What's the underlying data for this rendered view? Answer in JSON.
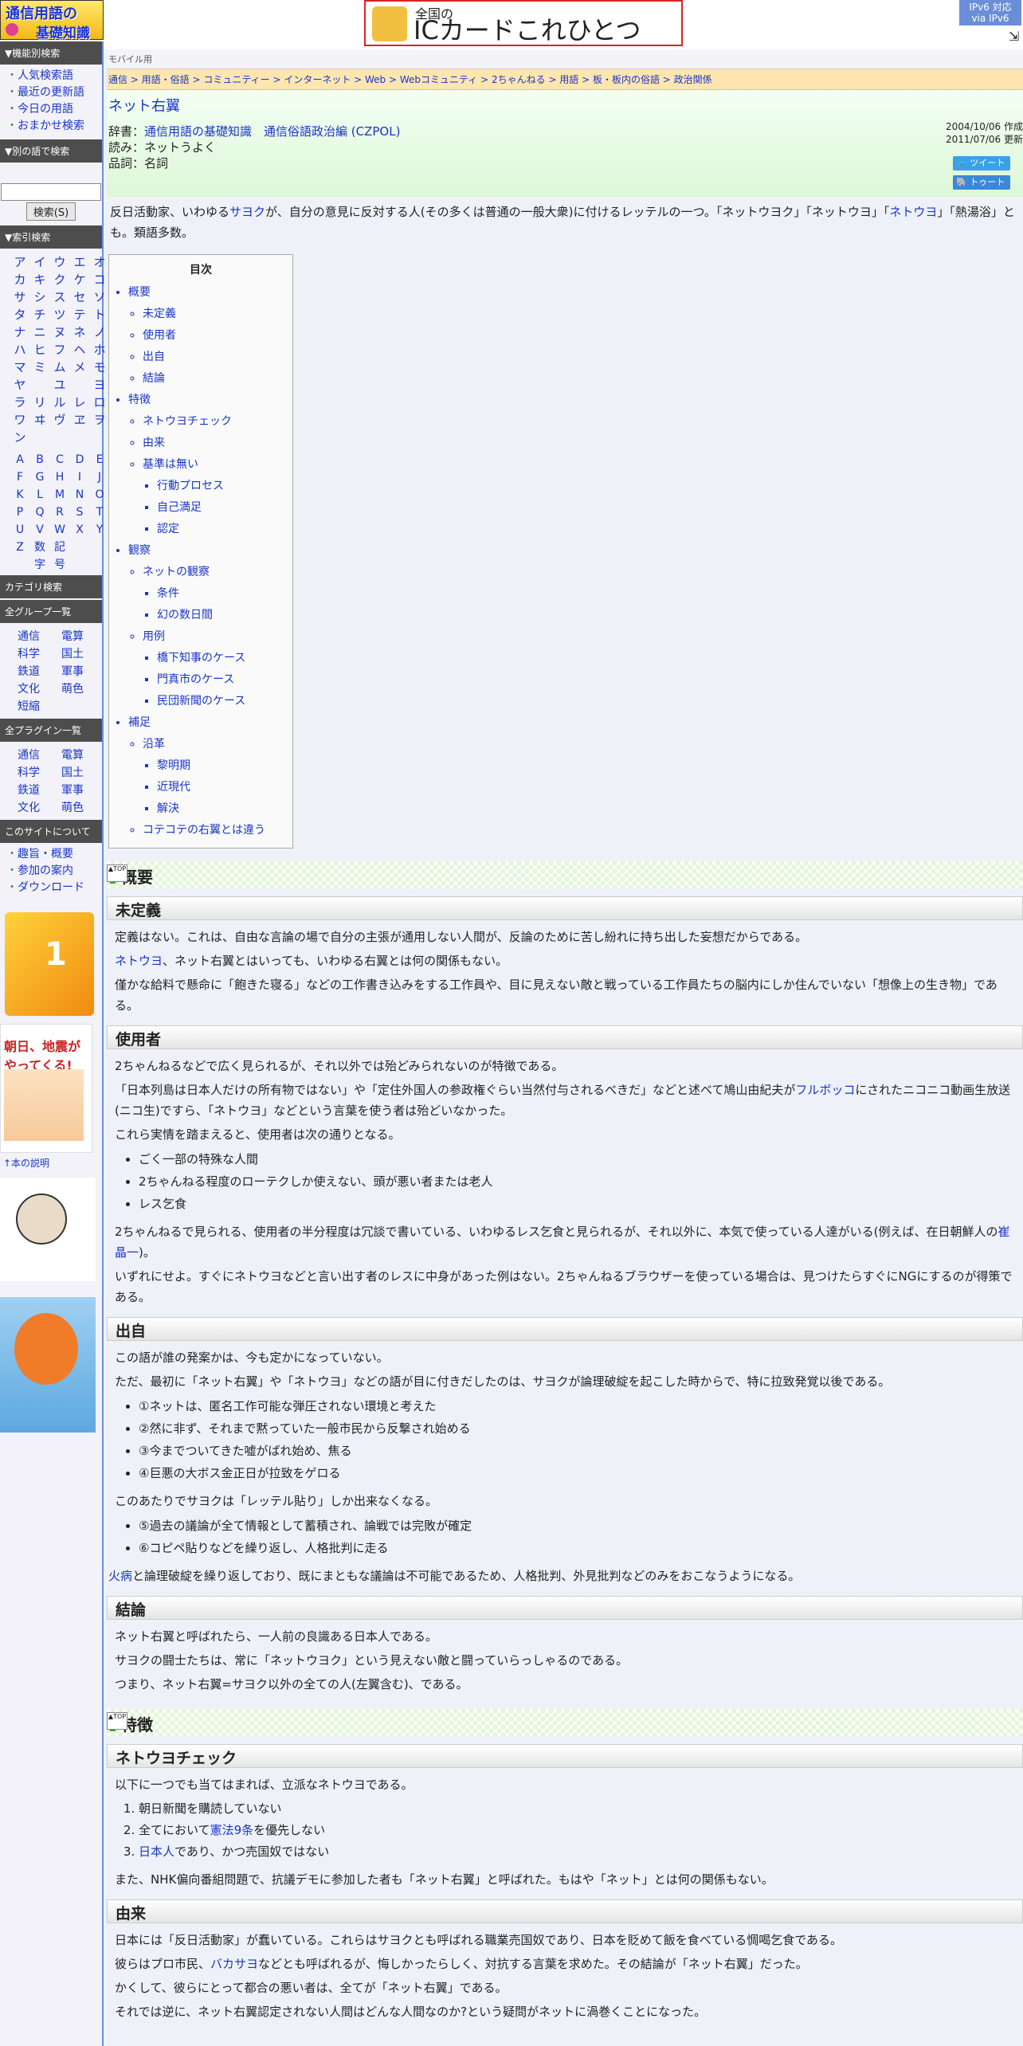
{
  "header": {
    "logo_line1": "通信用語の",
    "logo_line2": "基礎知識",
    "banner_small": "全国の",
    "banner_big": "ICカードこれひとつ",
    "ipv6_line1": "IPv6 対応",
    "ipv6_line2": "via IPv6"
  },
  "sidebar": {
    "sec1": "▼機能別検索",
    "sec1_items": [
      "人気検索語",
      "最近の更新語",
      "今日の用語",
      "おまかせ検索"
    ],
    "sec2": "▼別の語で検索",
    "search_btn": "検索(S)",
    "sec3": "▼索引検索",
    "kana": [
      "ア",
      "イ",
      "ウ",
      "エ",
      "オ",
      "カ",
      "キ",
      "ク",
      "ケ",
      "コ",
      "サ",
      "シ",
      "ス",
      "セ",
      "ソ",
      "タ",
      "チ",
      "ツ",
      "テ",
      "ト",
      "ナ",
      "ニ",
      "ヌ",
      "ネ",
      "ノ",
      "ハ",
      "ヒ",
      "フ",
      "ヘ",
      "ホ",
      "マ",
      "ミ",
      "ム",
      "メ",
      "モ",
      "ヤ",
      "",
      "ユ",
      "",
      "ヨ",
      "ラ",
      "リ",
      "ル",
      "レ",
      "ロ",
      "ワ",
      "ヰ",
      "ヴ",
      "ヱ",
      "ヲ",
      "ン",
      "",
      "",
      "",
      ""
    ],
    "alpha": [
      "A",
      "B",
      "C",
      "D",
      "E",
      "F",
      "G",
      "H",
      "I",
      "J",
      "K",
      "L",
      "M",
      "N",
      "O",
      "P",
      "Q",
      "R",
      "S",
      "T",
      "U",
      "V",
      "W",
      "X",
      "Y",
      "Z"
    ],
    "alpha_extra1": "数字",
    "alpha_extra2": "記号",
    "sec4": "カテゴリ検索",
    "sec5": "全グループ一覧",
    "groups": [
      "通信",
      "電算",
      "科学",
      "国土",
      "鉄道",
      "軍事",
      "文化",
      "萌色",
      "短縮"
    ],
    "sec6": "全プラグイン一覧",
    "plugins": [
      "通信",
      "電算",
      "科学",
      "国土",
      "鉄道",
      "軍事",
      "文化",
      "萌色"
    ],
    "sec7": "このサイトについて",
    "about_items": [
      "趣旨・概要",
      "参加の案内",
      "ダウンロード"
    ],
    "book_img_text": "朝日、地震がやってくる!",
    "book_desc": "↑本の説明"
  },
  "main": {
    "mobile": "モバイル用",
    "breadcrumb": "通信 > 用語・俗語 > コミュニティー > インターネット > Web > Webコミュニティ > 2ちゃんねる > 用語 > 板・板内の俗語 > 政治関係",
    "title": "ネット右翼",
    "dict_label": "辞書：",
    "dict_value": "通信用語の基礎知識　通信俗語政治編 (CZPOL)",
    "reading": "読み：ネットうよく",
    "pos": "品詞：名詞",
    "created": "2004/10/06 作成",
    "updated": "2011/07/06 更新",
    "tweet": "ツイート",
    "toot": "トゥート",
    "lead_pre": "反日活動家、いわゆる",
    "lead_l1": "サヨク",
    "lead_mid": "が、自分の意見に反対する人(その多くは普通の一般大衆)に付けるレッテルの一つ。「ネットウヨク」「ネットウヨ」「",
    "lead_l2": "ネトウヨ",
    "lead_post": "」「熱湯浴」とも。類語多数。"
  },
  "toc": {
    "title": "目次",
    "items": [
      "概要",
      "未定義",
      "使用者",
      "出自",
      "結論",
      "特徴",
      "ネトウヨチェック",
      "由来",
      "基準は無い",
      "行動プロセス",
      "自己満足",
      "認定",
      "観察",
      "ネットの観察",
      "条件",
      "幻の数日間",
      "用例",
      "橋下知事のケース",
      "門真市のケース",
      "民団新聞のケース",
      "補足",
      "沿革",
      "黎明期",
      "近現代",
      "解決",
      "コテコテの右翼とは違う"
    ]
  },
  "content": {
    "h_overview": "概要",
    "h_undef": "未定義",
    "undef_p1": "定義はない。これは、自由な言論の場で自分の主張が通用しない人間が、反論のために苦し紛れに持ち出した妄想だからである。",
    "undef_p2_link": "ネトウヨ",
    "undef_p2_rest": "、ネット右翼とはいっても、いわゆる右翼とは何の関係もない。",
    "undef_p3": "僅かな給料で懸命に「飽きた寝る」などの工作書き込みをする工作員や、目に見えない敵と戦っている工作員たちの脳内にしか住んでいない「想像上の生き物」である。",
    "h_users": "使用者",
    "users_p1": "2ちゃんねるなどで広く見られるが、それ以外では殆どみられないのが特徴である。",
    "users_p2_a": "「日本列島は日本人だけの所有物ではない」や「定住外国人の参政権ぐらい当然付与されるべきだ」などと述べて鳩山由紀夫が",
    "users_p2_link": "フルボッコ",
    "users_p2_b": "にされたニコニコ動画生放送(ニコ生)ですら、「ネトウヨ」などという言葉を使う者は殆どいなかった。",
    "users_p3": "これら実情を踏まえると、使用者は次の通りとなる。",
    "users_list": [
      "ごく一部の特殊な人間",
      "2ちゃんねる程度のローテクしか使えない、頭が悪い者または老人",
      "レス乞食"
    ],
    "users_p4_a": "2ちゃんねるで見られる、使用者の半分程度は冗談で書いている、いわゆるレス乞食と見られるが、それ以外に、本気で使っている人達がいる(例えば、在日朝鮮人の",
    "users_p4_link": "崔晶一",
    "users_p4_b": ")。",
    "users_p5": "いずれにせよ。すぐにネトウヨなどと言い出す者のレスに中身があった例はない。2ちゃんねるブラウザーを使っている場合は、見つけたらすぐにNGにするのが得策である。",
    "h_origin": "出自",
    "origin_p1": "この語が誰の発案かは、今も定かになっていない。",
    "origin_p2": "ただ、最初に「ネット右翼」や「ネトウヨ」などの語が目に付きだしたのは、サヨクが論理破綻を起こした時からで、特に拉致発覚以後である。",
    "origin_list1": [
      "①ネットは、匿名工作可能な弾圧されない環境と考えた",
      "②然に非ず、それまで黙っていた一般市民から反撃され始める",
      "③今までついてきた嘘がばれ始め、焦る",
      "④巨悪の大ボス金正日が拉致をゲロる"
    ],
    "origin_p3": "このあたりでサヨクは「レッテル貼り」しか出来なくなる。",
    "origin_list2": [
      "⑤過去の議論が全て情報として蓄積され、論戦では完敗が確定",
      "⑥コピペ貼りなどを繰り返し、人格批判に走る"
    ],
    "origin_p4_link": "火病",
    "origin_p4_rest": "と論理破綻を繰り返しており、既にまともな議論は不可能であるため、人格批判、外見批判などのみをおこなうようになる。",
    "h_concl": "結論",
    "concl_p1": "ネット右翼と呼ばれたら、一人前の良識ある日本人である。",
    "concl_p2": "サヨクの闘士たちは、常に「ネットウヨク」という見えない敵と闘っていらっしゃるのである。",
    "concl_p3": "つまり、ネット右翼=サヨク以外の全ての人(左翼含む)、である。",
    "h_features": "特徴",
    "h_check": "ネトウヨチェック",
    "check_p1": "以下に一つでも当てはまれば、立派なネトウヨである。",
    "check_1": "朝日新聞を購読していない",
    "check_2_a": "全てにおいて",
    "check_2_link": "憲法9条",
    "check_2_b": "を優先しない",
    "check_3_link": "日本人",
    "check_3_b": "であり、かつ売国奴ではない",
    "check_p2": "また、NHK偏向番組問題で、抗議デモに参加した者も「ネット右翼」と呼ばれた。もはや「ネット」とは何の関係もない。",
    "h_reason": "由来",
    "reason_p1": "日本には「反日活動家」が蠢いている。これらはサヨクとも呼ばれる職業売国奴であり、日本を貶めて飯を食べている惆喝乞食である。",
    "reason_p2_a": "彼らはプロ市民、",
    "reason_p2_link": "バカサヨ",
    "reason_p2_b": "などとも呼ばれるが、悔しかったらしく、対抗する言葉を求めた。その結論が「ネット右翼」だった。",
    "reason_p3": "かくして、彼らにとって都合の悪い者は、全てが「ネット右翼」である。",
    "reason_p4": "それでは逆に、ネット右翼認定されない人間はどんな人間なのか?という疑問がネットに渦巻くことになった。"
  },
  "colors": {
    "accent": "#6a8ed8",
    "link": "#1a35c8",
    "green": "#2eac2e"
  }
}
